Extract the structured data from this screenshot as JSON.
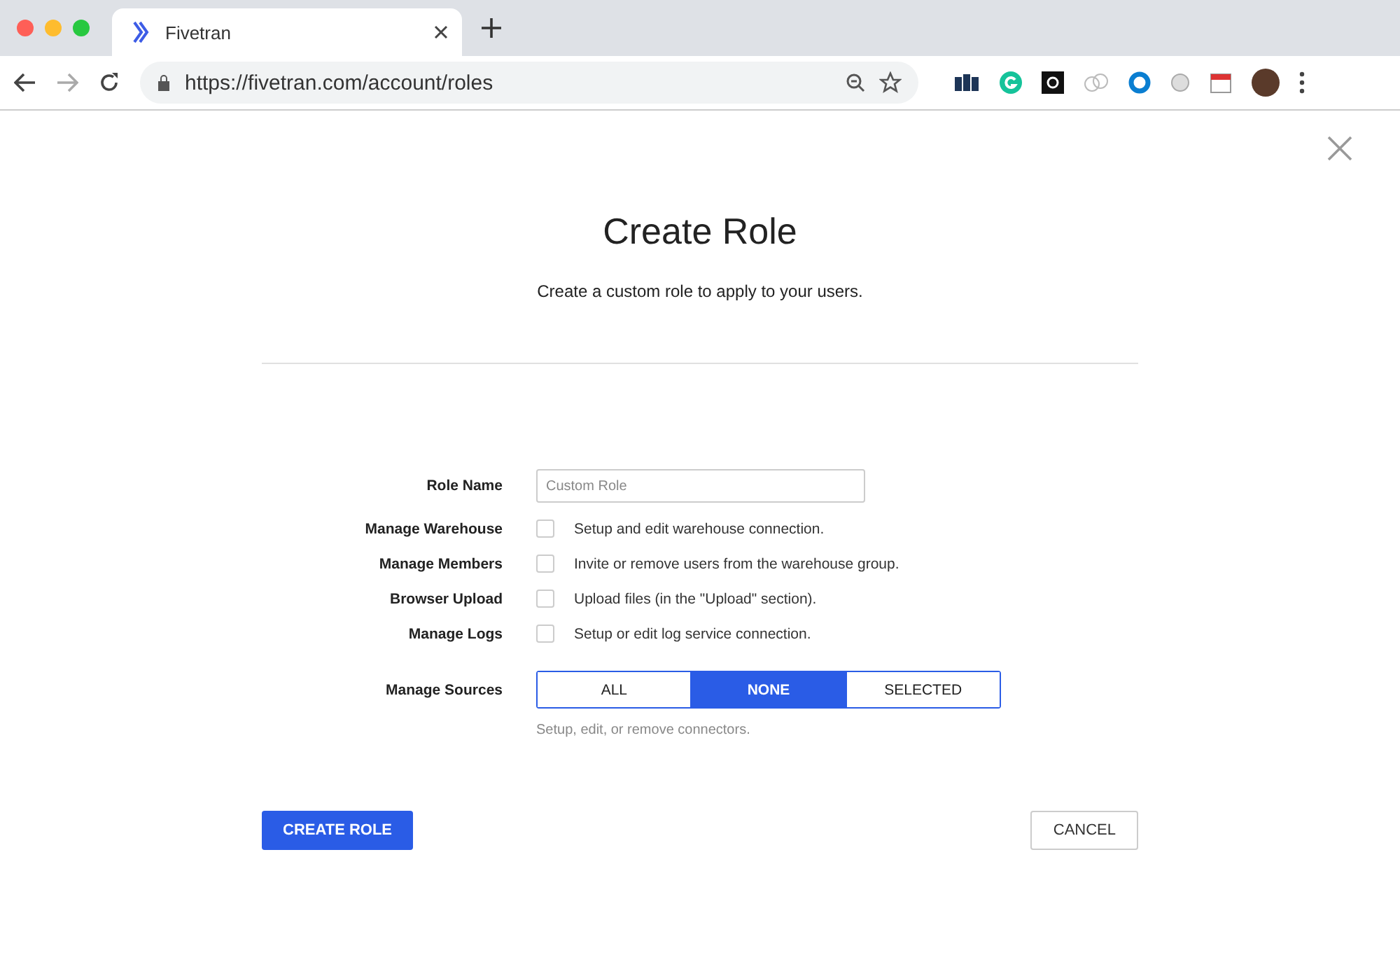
{
  "browser": {
    "tab_title": "Fivetran",
    "url": "https://fivetran.com/account/roles"
  },
  "dialog": {
    "title": "Create Role",
    "subtitle": "Create a custom role to apply to your users.",
    "role_name": {
      "label": "Role Name",
      "placeholder": "Custom Role"
    },
    "permissions": [
      {
        "label": "Manage Warehouse",
        "description": "Setup and edit warehouse connection.",
        "checked": false
      },
      {
        "label": "Manage Members",
        "description": "Invite or remove users from the warehouse group.",
        "checked": false
      },
      {
        "label": "Browser Upload",
        "description": "Upload files (in the \"Upload\" section).",
        "checked": false
      },
      {
        "label": "Manage Logs",
        "description": "Setup or edit log service connection.",
        "checked": false
      }
    ],
    "sources": {
      "label": "Manage Sources",
      "options": [
        {
          "label": "ALL",
          "selected": false
        },
        {
          "label": "NONE",
          "selected": true
        },
        {
          "label": "SELECTED",
          "selected": false
        }
      ],
      "help": "Setup, edit, or remove connectors."
    },
    "buttons": {
      "create": "CREATE ROLE",
      "cancel": "CANCEL"
    }
  }
}
